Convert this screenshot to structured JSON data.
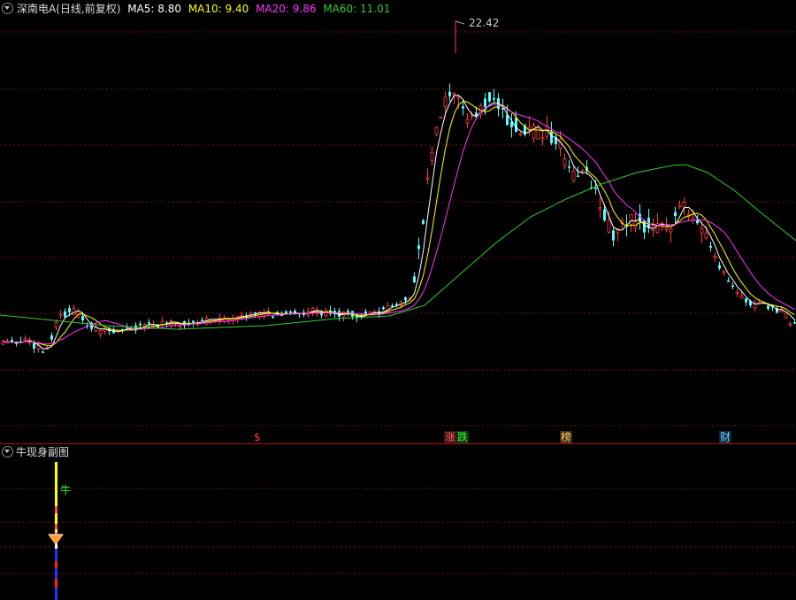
{
  "main_panel": {
    "stock_title": "深南电A(日线,前复权)",
    "ma_labels": [
      {
        "text": "MA5: 8.80",
        "color": "#ffffff"
      },
      {
        "text": "MA10: 9.40",
        "color": "#ffff00"
      },
      {
        "text": "MA20: 9.86",
        "color": "#ff33ff"
      },
      {
        "text": "MA60: 11.01",
        "color": "#33cc33"
      }
    ],
    "peak_label": "22.42",
    "event_markers": [
      {
        "text": "$",
        "color": "#ff3333",
        "bg": "transparent"
      },
      {
        "text": "涨",
        "color": "#ff6666",
        "bg": "#3a1010"
      },
      {
        "text": "跌",
        "color": "#33ff33",
        "bg": "#103010"
      },
      {
        "text": "榜",
        "color": "#ffcc66",
        "bg": "#3a2a10"
      },
      {
        "text": "财",
        "color": "#66ccff",
        "bg": "#10283a"
      }
    ]
  },
  "sub_panel": {
    "title": "牛现身副图",
    "bull_label": "牛"
  },
  "colors": {
    "up": "#ff3c3c",
    "down": "#54ffff",
    "ma5": "#ffffff",
    "ma10": "#ffff00",
    "ma20": "#ff33ff",
    "ma60": "#33cc33",
    "grid": "#7a0f0f",
    "divider": "#b01010"
  },
  "chart_data": {
    "type": "candlestick",
    "symbol": "深南电A",
    "period": "日线",
    "adjustment": "前复权",
    "peak_high": 22.42,
    "ma": {
      "MA5": 8.8,
      "MA10": 9.4,
      "MA20": 9.86,
      "MA60": 11.01
    }
  }
}
